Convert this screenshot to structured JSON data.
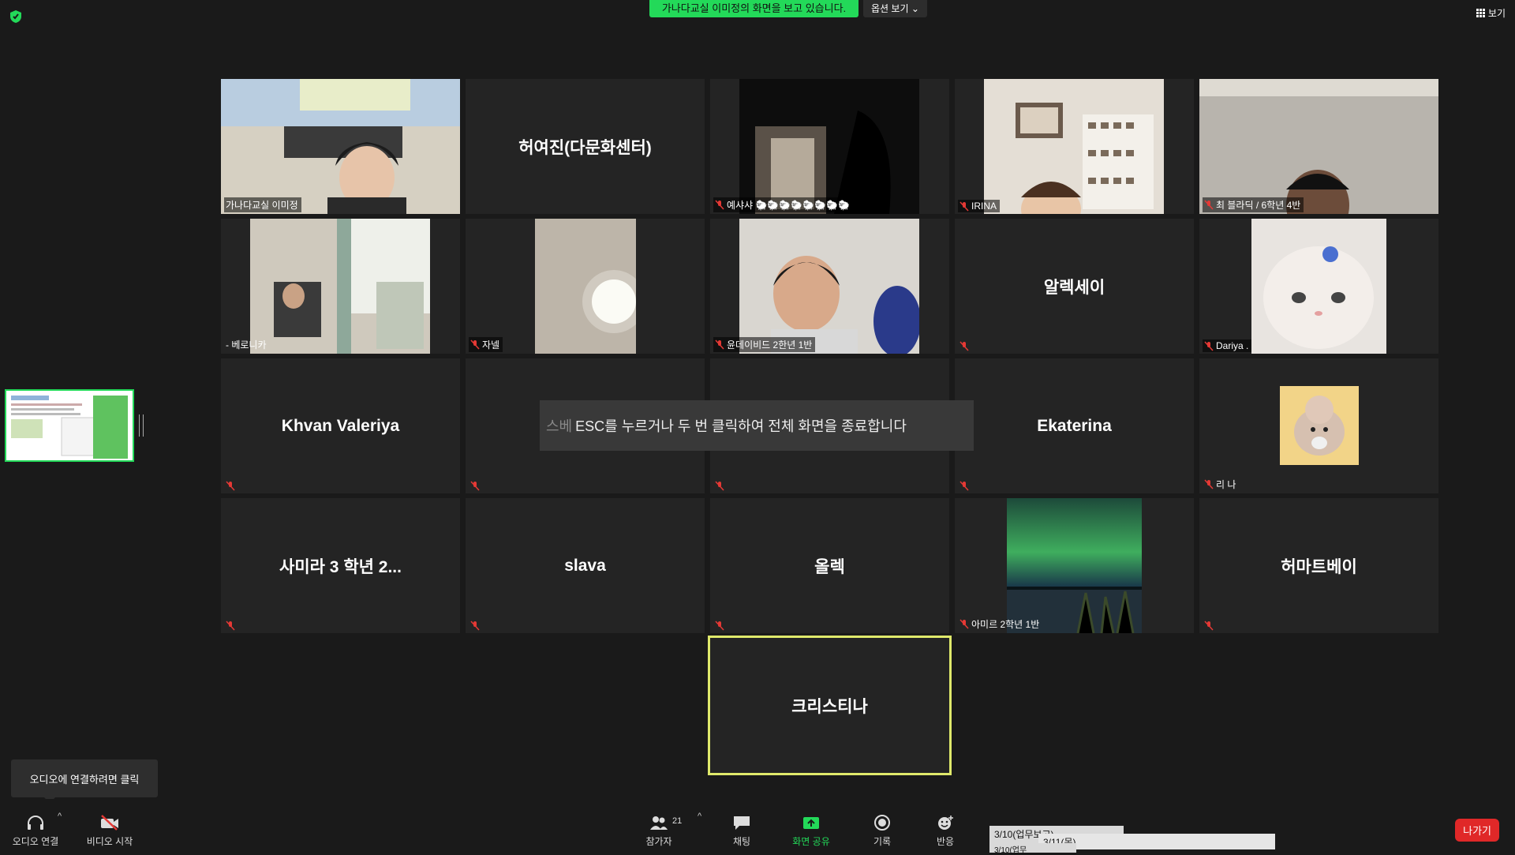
{
  "header": {
    "banner": "가나다교실 이미정의 화면을 보고 있습니다.",
    "view_options": "옵션 보기 ⌄",
    "view": "보기"
  },
  "tiles": [
    {
      "label": "가나다교실 이미정",
      "video": true,
      "muted": false
    },
    {
      "big": "허여진(다문화센터)"
    },
    {
      "label": "예샤샤 🐑🐑🐑🐑🐑🐑🐑🐑",
      "video": true,
      "muted": true
    },
    {
      "label": "IRINA",
      "video": true,
      "muted": true
    },
    {
      "label": "최 블라딕 / 6학년 4반",
      "video": true,
      "muted": true
    },
    {
      "label": "- 베로니카",
      "video": true,
      "muted": false
    },
    {
      "label": "자넬",
      "video": true,
      "muted": true
    },
    {
      "label": "윤데이비드 2한년 1반",
      "video": true,
      "muted": true
    },
    {
      "big": "알렉세이",
      "muted": true
    },
    {
      "label": "Dariya .",
      "video": true,
      "muted": true
    },
    {
      "big": "Khvan Valeriya",
      "muted": true
    },
    {
      "big": "",
      "muted": true
    },
    {
      "big": "",
      "muted": true
    },
    {
      "big": "Ekaterina",
      "muted": true
    },
    {
      "label": "리 나",
      "video": true,
      "muted": true
    },
    {
      "big": "사미라 3 학년 2...",
      "muted": true
    },
    {
      "big": "slava",
      "muted": true
    },
    {
      "big": "올렉",
      "muted": true
    },
    {
      "label": "아미르 2학년 1반",
      "video": true,
      "muted": true
    },
    {
      "big": "허마트베이",
      "muted": true
    },
    {
      "big": "크리스티나",
      "active": true
    }
  ],
  "esc_overlay": {
    "dim": "스베",
    "text": "ESC를 누르거나 두 번 클릭하여 전체 화면을 종료합니다"
  },
  "tooltip": "오디오에 연결하려면 클릭",
  "toolbar": {
    "audio": "오디오 연결",
    "video": "비디오 시작",
    "participants": "참가자",
    "participants_count": "21",
    "chat": "채팅",
    "share": "화면 공유",
    "record": "기록",
    "reactions": "반응",
    "leave": "나가기"
  },
  "taskbar": {
    "win1": "3/10(업무보고)",
    "win2": "3/11(목)",
    "win3": "3/10(업무"
  },
  "colors": {
    "accent_green": "#23d959",
    "leave_red": "#e02828",
    "active_border": "#dfe96b"
  }
}
